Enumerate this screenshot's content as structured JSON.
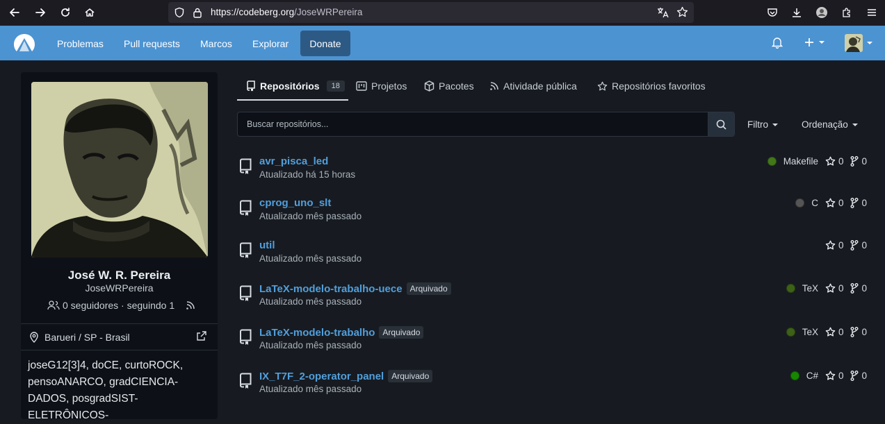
{
  "browser": {
    "url_host": "https://codeberg.org",
    "url_path": "/JoseWRPereira"
  },
  "header": {
    "nav": [
      {
        "label": "Problemas"
      },
      {
        "label": "Pull requests"
      },
      {
        "label": "Marcos"
      },
      {
        "label": "Explorar"
      }
    ],
    "donate_label": "Donate"
  },
  "profile": {
    "name": "José W. R. Pereira",
    "username": "JoseWRPereira",
    "followers_text": "0 seguidores · seguindo 1",
    "location": "Barueri / SP - Brasil",
    "bio": "joseG12[3]4, doCE, curtoROCK, pensoANARCO, gradCIENCIA-DADOS, posgradSIST-ELETRÔNICOS-"
  },
  "tabs": [
    {
      "label": "Repositórios",
      "count": "18"
    },
    {
      "label": "Projetos"
    },
    {
      "label": "Pacotes"
    },
    {
      "label": "Atividade pública"
    },
    {
      "label": "Repositórios favoritos"
    }
  ],
  "search": {
    "placeholder": "Buscar repositórios...",
    "filter_label": "Filtro",
    "sort_label": "Ordenação"
  },
  "repos": [
    {
      "name": "avr_pisca_led",
      "updated": "Atualizado há 15 horas",
      "archived": "",
      "language": "Makefile",
      "lang_color": "#427819",
      "stars": "0",
      "forks": "0"
    },
    {
      "name": "cprog_uno_slt",
      "updated": "Atualizado mês passado",
      "archived": "",
      "language": "C",
      "lang_color": "#555555",
      "stars": "0",
      "forks": "0"
    },
    {
      "name": "util",
      "updated": "Atualizado mês passado",
      "archived": "",
      "language": "",
      "lang_color": "",
      "stars": "0",
      "forks": "0"
    },
    {
      "name": "LaTeX-modelo-trabalho-uece",
      "updated": "Atualizado mês passado",
      "archived": "Arquivado",
      "language": "TeX",
      "lang_color": "#3D6117",
      "stars": "0",
      "forks": "0"
    },
    {
      "name": "LaTeX-modelo-trabalho",
      "updated": "Atualizado mês passado",
      "archived": "Arquivado",
      "language": "TeX",
      "lang_color": "#3D6117",
      "stars": "0",
      "forks": "0"
    },
    {
      "name": "IX_T7F_2-operator_panel",
      "updated": "Atualizado mês passado",
      "archived": "Arquivado",
      "language": "C#",
      "lang_color": "#178600",
      "stars": "0",
      "forks": "0"
    }
  ],
  "colors": {
    "header_bg": "#4c93d2",
    "link": "#519fdc",
    "page_bg": "#171b21"
  }
}
